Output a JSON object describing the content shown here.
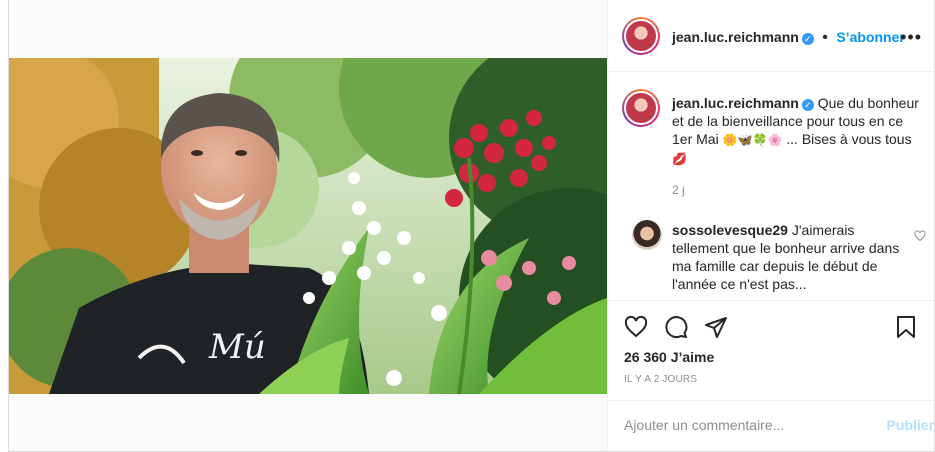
{
  "post": {
    "author": "jean.luc.reichmann",
    "verified": true,
    "follow_label": "S’abonner",
    "more_label": "•••",
    "caption_text": "Que du bonheur et de la bienveillance pour tous en ce 1er Mai",
    "caption_emojis": [
      "🌼",
      "🦋",
      "🍀",
      "🌸"
    ],
    "caption_tail": "... Bises à vous tous",
    "caption_end_emoji": "💋",
    "caption_time": "2 j",
    "icons": [
      "heart-icon",
      "comment-icon",
      "share-icon",
      "bookmark-icon",
      "more-icon",
      "verified-icon",
      "small-heart-icon"
    ]
  },
  "comment": {
    "user": "sossolevesque29",
    "text": "J'aimerais tellement que le bonheur arrive dans ma famille car depuis le début de l'année ce n'est pas..."
  },
  "stats": {
    "likes": "26 360 J’aime",
    "posted": "IL Y A 2 JOURS"
  },
  "add_comment": {
    "placeholder": "Ajouter un commentaire...",
    "publish_label": "Publier"
  },
  "colors": {
    "accent": "#0095f6",
    "publish_disabled": "#b2dffc",
    "verified": "#3897f0"
  }
}
